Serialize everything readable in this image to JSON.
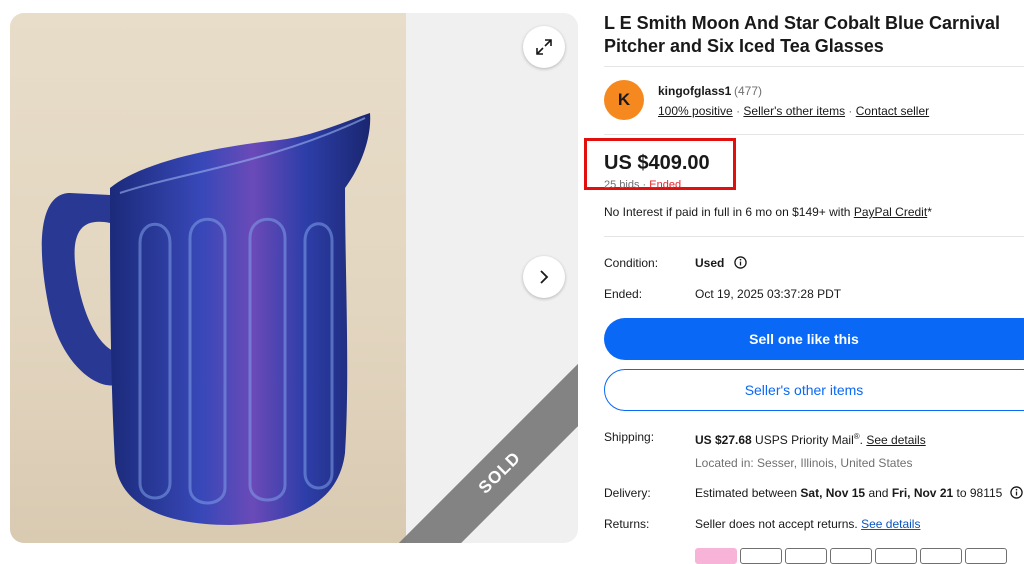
{
  "gallery": {
    "sold_label": "SOLD",
    "expand_icon": "expand-icon",
    "next_icon": "chevron-right-icon"
  },
  "listing": {
    "title": "L E Smith Moon And Star Cobalt Blue Carnival Pitcher and Six Iced Tea Glasses"
  },
  "seller": {
    "avatar_letter": "K",
    "name": "kingofglass1",
    "feedback_count": "(477)",
    "positive": "100% positive",
    "other_items_link": "Seller's other items",
    "contact_link": "Contact seller",
    "separator": "·"
  },
  "price": {
    "amount": "US $409.00",
    "bids": "25 bids",
    "status": "Ended",
    "separator": "·",
    "highlight_color": "#e20f0f"
  },
  "finance": {
    "text": "No Interest if paid in full in 6 mo on $149+ with ",
    "link": "PayPal Credit",
    "suffix": "*"
  },
  "details": {
    "condition_label": "Condition:",
    "condition_value": "Used",
    "info_icon": "info-icon",
    "ended_label": "Ended:",
    "ended_value": "Oct 19, 2025 03:37:28 PDT"
  },
  "actions": {
    "sell_label": "Sell one like this",
    "other_items_label": "Seller's other items",
    "primary_color": "#0968f6"
  },
  "shipping": {
    "label": "Shipping:",
    "cost": "US $27.68",
    "service": " USPS Priority Mail",
    "registered": "®",
    "period": ". ",
    "details_link": "See details",
    "location": "Located in: Sesser, Illinois, United States"
  },
  "delivery": {
    "label": "Delivery:",
    "prefix": "Estimated between ",
    "start": "Sat, Nov 15",
    "and": " and ",
    "end": "Fri, Nov 21",
    "to": " to 98115"
  },
  "returns": {
    "label": "Returns:",
    "text": "Seller does not accept returns. ",
    "link": "See details"
  }
}
